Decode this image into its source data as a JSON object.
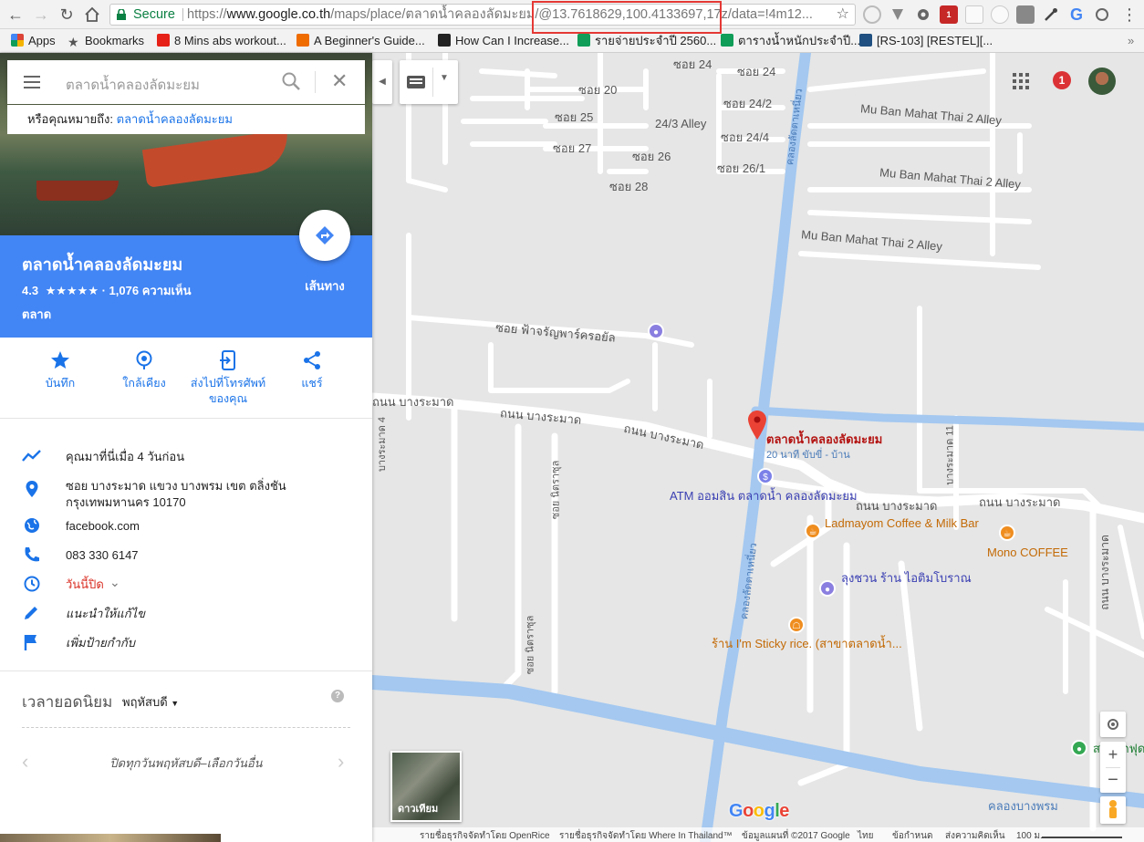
{
  "browser": {
    "secure_label": "Secure",
    "url_scheme": "https://",
    "url_host": "www.google.co.th",
    "url_path": "/maps/place/ตลาดน้ำคลองลัดมะยม/@13.7618629,100.4133697,17z/data=!4m12...",
    "extension_badge": "1"
  },
  "bookmarks": [
    {
      "label": "Apps",
      "icon": "apps-grid-icon",
      "color": "#4285f4"
    },
    {
      "label": "Bookmarks",
      "icon": "star-icon",
      "color": "#555555"
    },
    {
      "label": "8 Mins abs workout...",
      "icon": "youtube-icon",
      "color": "#e62117"
    },
    {
      "label": "A Beginner's Guide...",
      "icon": "m-logo-icon",
      "color": "#ef6c00"
    },
    {
      "label": "How Can I Increase...",
      "icon": "m-dark-logo-icon",
      "color": "#222222"
    },
    {
      "label": "รายจ่ายประจำปี 2560...",
      "icon": "sheets-icon",
      "color": "#0f9d58"
    },
    {
      "label": "ตารางน้ำหนักประจำปี...",
      "icon": "sheets-icon",
      "color": "#0f9d58"
    },
    {
      "label": "[RS-103] [RESTEL][...",
      "icon": "jira-icon",
      "color": "#205081"
    }
  ],
  "panel": {
    "search_value": "ตลาดน้ำคลองลัดมะยม",
    "did_you_mean_prefix": "หรือคุณหมายถึง:",
    "did_you_mean_link": "ตลาดน้ำคลองลัดมะยม",
    "place_title": "ตลาดน้ำคลองลัดมะยม",
    "rating_value": "4.3",
    "rating_stars": "★★★★★",
    "review_count": "· 1,076 ความเห็น",
    "category": "ตลาด",
    "directions_label": "เส้นทาง",
    "actions": [
      {
        "label": "บันทึก",
        "icon": "star-icon"
      },
      {
        "label": "ใกล้เคียง",
        "icon": "nearby-icon"
      },
      {
        "label": "ส่งไปที่โทรศัพท์ของคุณ",
        "icon": "send-to-phone-icon"
      },
      {
        "label": "แชร์",
        "icon": "share-icon"
      }
    ],
    "visited": "คุณมาที่นี่เมื่อ 4 วันก่อน",
    "address_line1": "ซอย บางระมาด แขวง บางพรม เขต ตลิ่งชัน",
    "address_line2": "กรุงเทพมหานคร 10170",
    "website": "facebook.com",
    "phone": "083 330 6147",
    "hours": "วันนี้ปิด",
    "suggest_edit": "แนะนำให้แก้ไข",
    "add_label": "เพิ่มป้ายกำกับ",
    "popular_times_title": "เวลายอดนิยม",
    "popular_day": "พฤหัสบดี",
    "popular_closed": "ปิดทุกวันพฤหัสบดี–เลือกวันอื่น",
    "colors": {
      "accent": "#4285f4",
      "link": "#1a73e8",
      "closed": "#d93025"
    }
  },
  "map": {
    "notification_count": "1",
    "satellite_label": "ดาวเทียม",
    "google_logo": "Google",
    "marker_name": "ตลาดน้ำคลองลัดมะยม",
    "marker_travel": "20 นาที ขับขี่ - บ้าน",
    "street_labels": {
      "soi24a": "ซอย 24",
      "soi24b": "ซอย 24",
      "soi20": "ซอย 20",
      "soi242": "ซอย 24/2",
      "soi25": "ซอย 25",
      "alley243": "24/3 Alley",
      "soi244": "ซอย 24/4",
      "soi27": "ซอย 27",
      "soi26": "ซอย 26",
      "soi261": "ซอย 26/1",
      "soi28": "ซอย 28",
      "mubanA": "Mu Ban Mahat Thai 2 Alley",
      "mubanB": "Mu Ban Mahat Thai 2 Alley",
      "mubanC": "Mu Ban Mahat Thai 2 Alley",
      "khlong1": "คลองลัดตาเหนี่ยว",
      "khlong2": "คลองลัดตาเหนี่ยว",
      "faroyal": "ซอย ฟ้าจรัญพาร์ครอยัล",
      "road1": "ถนน บางระมาด",
      "road2": "ถนน บางระมาด",
      "road3": "ถนน บางระมาด",
      "road4": "ถนน บางระมาด",
      "road5": "ถนน บางระมาด",
      "bangramat4": "บางระมาด 4",
      "bangramat11": "บางระมาด 11",
      "bangramat_r": "ถนน บางระมาด",
      "nithat1": "ซอย นิตราซุล",
      "nithat2": "ซอย นิตราซุล",
      "bangphrom": "คลองบางพรม"
    },
    "pois": {
      "atm": "ATM ออมสิน ตลาดน้ำ คลองลัดมะยม",
      "ladmayom": "Ladmayom Coffee & Milk Bar",
      "mono": "Mono COFFEE",
      "lungchuan": "ลุงชวน ร้าน ไอติมโบราณ",
      "sticky": "ร้าน I'm Sticky rice. (สาขาตลาดน้ำ..."
    },
    "right_edge_label": "สวนผักฟุด",
    "attribution": [
      "รายชื่อธุรกิจจัดทำโดย OpenRice",
      "รายชื่อธุรกิจจัดทำโดย Where In Thailand™",
      "ข้อมูลแผนที่ ©2017 Google",
      "ไทย",
      "ข้อกำหนด",
      "ส่งความคิดเห็น",
      "100 ม."
    ]
  }
}
